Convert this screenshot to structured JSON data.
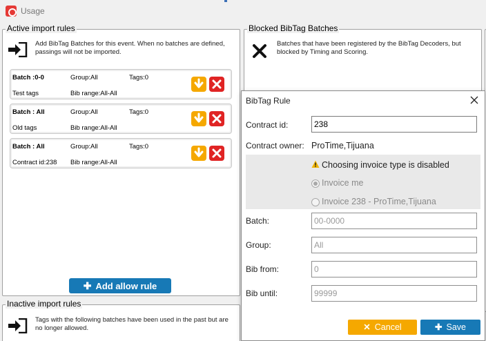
{
  "window": {
    "title": "Usage"
  },
  "active": {
    "legend": "Active import rules",
    "description": [
      "Add BibTag Batches for this event. When no batches are defined,",
      "passings will not be imported."
    ],
    "rules": [
      {
        "batch": "Batch :0-0",
        "group": "Group:All",
        "tags": "Tags:0",
        "name": "Test tags",
        "bib_range": "Bib range:All-All"
      },
      {
        "batch": "Batch : All",
        "group": "Group:All",
        "tags": "Tags:0",
        "name": "Old tags",
        "bib_range": "Bib range:All-All"
      },
      {
        "batch": "Batch : All",
        "group": "Group:All",
        "tags": "Tags:0",
        "name": "Contract id:238",
        "bib_range": "Bib range:All-All"
      }
    ],
    "add_button": "Add allow rule"
  },
  "blocked": {
    "legend": "Blocked BibTag Batches",
    "description": [
      "Batches that have been registered by the BibTag Decoders, but",
      "blocked by Timing and Scoring."
    ]
  },
  "inactive": {
    "legend": "Inactive import rules",
    "description": [
      "Tags with the following batches have been used in the past but are",
      "no longer allowed."
    ]
  },
  "dialog": {
    "title": "BibTag Rule",
    "contract_id_label": "Contract id:",
    "contract_id_value": "238",
    "owner_label": "Contract owner:",
    "owner_value": "ProTime,Tijuana",
    "warning": "Choosing invoice type is disabled",
    "invoice_options": [
      "Invoice me",
      "Invoice 238 - ProTime,Tijuana"
    ],
    "invoice_selected": "Invoice me",
    "batch_label": "Batch:",
    "batch_placeholder": "00-0000",
    "group_label": "Group:",
    "group_placeholder": "All",
    "bib_from_label": "Bib from:",
    "bib_from_placeholder": "0",
    "bib_until_label": "Bib until:",
    "bib_until_placeholder": "99999",
    "cancel_label": "Cancel",
    "save_label": "Save"
  },
  "colors": {
    "accent_blue": "#1779b6",
    "warning_orange": "#f5a800",
    "danger_red": "#e02424"
  },
  "icons": [
    "app-icon",
    "arrow-into-icon",
    "x-mark-icon",
    "arrow-down-icon",
    "delete-icon",
    "plus-icon",
    "warning-icon",
    "close-icon"
  ]
}
